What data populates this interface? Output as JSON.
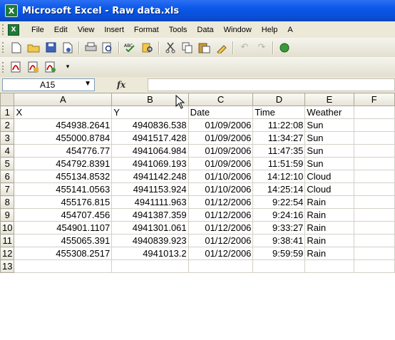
{
  "window": {
    "title": "Microsoft Excel - Raw data.xls",
    "app_icon": "X"
  },
  "menu": [
    "File",
    "Edit",
    "View",
    "Insert",
    "Format",
    "Tools",
    "Data",
    "Window",
    "Help",
    "A"
  ],
  "formula_bar": {
    "name_box": "A15",
    "fx_label": "fx",
    "formula": ""
  },
  "grid": {
    "columns": [
      "A",
      "B",
      "C",
      "D",
      "E",
      "F"
    ],
    "rows": [
      {
        "n": "1",
        "cells": [
          "X",
          "Y",
          "Date",
          "Time",
          "Weather"
        ]
      },
      {
        "n": "2",
        "cells": [
          "454938.2641",
          "4940836.538",
          "01/09/2006",
          "11:22:08",
          "Sun"
        ]
      },
      {
        "n": "3",
        "cells": [
          "455000.8784",
          "4941517.428",
          "01/09/2006",
          "11:34:27",
          "Sun"
        ]
      },
      {
        "n": "4",
        "cells": [
          "454776.77",
          "4941064.984",
          "01/09/2006",
          "11:47:35",
          "Sun"
        ]
      },
      {
        "n": "5",
        "cells": [
          "454792.8391",
          "4941069.193",
          "01/09/2006",
          "11:51:59",
          "Sun"
        ]
      },
      {
        "n": "6",
        "cells": [
          "455134.8532",
          "4941142.248",
          "01/10/2006",
          "14:12:10",
          "Cloud"
        ]
      },
      {
        "n": "7",
        "cells": [
          "455141.0563",
          "4941153.924",
          "01/10/2006",
          "14:25:14",
          "Cloud"
        ]
      },
      {
        "n": "8",
        "cells": [
          "455176.815",
          "4941111.963",
          "01/12/2006",
          "9:22:54",
          "Rain"
        ]
      },
      {
        "n": "9",
        "cells": [
          "454707.456",
          "4941387.359",
          "01/12/2006",
          "9:24:16",
          "Rain"
        ]
      },
      {
        "n": "10",
        "cells": [
          "454901.1107",
          "4941301.061",
          "01/12/2006",
          "9:33:27",
          "Rain"
        ]
      },
      {
        "n": "11",
        "cells": [
          "455065.391",
          "4940839.923",
          "01/12/2006",
          "9:38:41",
          "Rain"
        ]
      },
      {
        "n": "12",
        "cells": [
          "455308.2517",
          "4941013.2",
          "01/12/2006",
          "9:59:59",
          "Rain"
        ]
      },
      {
        "n": "13",
        "cells": [
          "",
          "",
          "",
          "",
          ""
        ]
      }
    ]
  },
  "colors": {
    "titlebar": "#0a58e8",
    "chrome": "#ece9d8",
    "gridline": "#d4d0c8"
  }
}
